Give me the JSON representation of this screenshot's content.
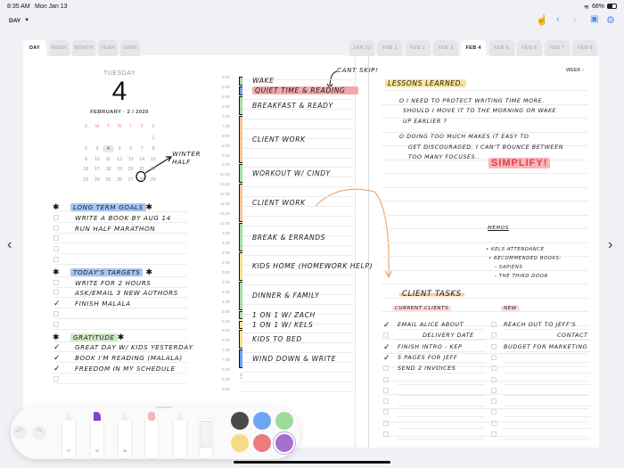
{
  "status_bar": {
    "time": "8:35 AM",
    "date": "Mon Jan 13",
    "battery": "68%"
  },
  "view_selector": {
    "label": "DAY"
  },
  "view_tabs": [
    "DAY",
    "WEEK",
    "MONTH",
    "YEAR",
    "GRID"
  ],
  "date_tabs": [
    "JAN 31",
    "FEB 1",
    "FEB 2",
    "FEB 3",
    "FEB 4",
    "FEB 5",
    "FEB 6",
    "FEB 7",
    "FEB 8"
  ],
  "active_date_tab": "FEB 4",
  "day_header": {
    "weekday": "TUESDAY",
    "day": "4",
    "month_line": "FEBRUARY · 2 / 2020"
  },
  "mini_calendar": {
    "weekdays": [
      "S",
      "M",
      "T",
      "W",
      "T",
      "F",
      "S"
    ],
    "first_weekday": 6,
    "days_in_month": 29,
    "selected": 4,
    "annotation": "WINTER HALF"
  },
  "left_lists": [
    {
      "type": "header",
      "text": "LONG TERM GOALS",
      "highlight": "#a9c6f5"
    },
    {
      "text": "WRITE A BOOK BY AUG 14"
    },
    {
      "text": "RUN HALF MARATHON"
    },
    {
      "text": ""
    },
    {
      "text": ""
    },
    {
      "text": ""
    },
    {
      "type": "header",
      "text": "TODAY'S TARGETS",
      "highlight": "#a9c6f5"
    },
    {
      "text": "WRITE FOR 2 HOURS"
    },
    {
      "text": "ASK/EMAIL 3 NEW AUTHORS"
    },
    {
      "text": "FINISH MALALA",
      "checked": true
    },
    {
      "text": ""
    },
    {
      "text": ""
    },
    {
      "type": "header",
      "text": "GRATITUDE",
      "highlight": "#cfe8c6"
    },
    {
      "text": "GREAT DAY W/ KIDS YESTERDAY",
      "checked": true
    },
    {
      "text": "BOOK I'M READING (MALALA)",
      "checked": true
    },
    {
      "text": "FREEDOM IN MY SCHEDULE",
      "checked": true
    },
    {
      "text": ""
    }
  ],
  "schedule": {
    "times": [
      "5:00",
      "5:30",
      "6:00",
      "6:30",
      "7:00",
      "7:30",
      "8:00",
      "8:30",
      "9:00",
      "9:30",
      "10:00",
      "10:30",
      "11:00",
      "11:30",
      "12:00",
      "12:30",
      "1:00",
      "1:30",
      "2:00",
      "2:30",
      "3:00",
      "3:30",
      "4:00",
      "4:30",
      "5:00",
      "5:30",
      "6:00",
      "6:30",
      "7:00",
      "7:30",
      "8:00",
      "8:30",
      "9:00"
    ],
    "annotation": "CANT SKIP!",
    "events": [
      {
        "start": 0,
        "end": 1,
        "text": "WAKE",
        "color": "#a6dba0"
      },
      {
        "start": 1,
        "end": 2,
        "text": "QUIET TIME & READING",
        "color": "#6d9ef0",
        "highlight": "#f2a9ad"
      },
      {
        "start": 2,
        "end": 4,
        "text": "BREAKFAST & READY",
        "color": "#a6dba0"
      },
      {
        "start": 4,
        "end": 9,
        "text": "CLIENT WORK",
        "color": "#f5c39a"
      },
      {
        "start": 9,
        "end": 11,
        "text": "WORKOUT W/ CINDY",
        "color": "#a6dba0"
      },
      {
        "start": 11,
        "end": 15,
        "text": "CLIENT WORK",
        "color": "#f5c39a"
      },
      {
        "start": 15,
        "end": 18,
        "text": "BREAK & ERRANDS",
        "color": "#a6dba0"
      },
      {
        "start": 18,
        "end": 21,
        "text": "KIDS HOME (HOMEWORK HELP)",
        "color": "#f3e08f"
      },
      {
        "start": 21,
        "end": 24,
        "text": "DINNER & FAMILY",
        "color": "#a6dba0"
      },
      {
        "start": 24,
        "end": 25,
        "text": "1 ON 1  W/ ZACH",
        "color": "#a6dba0"
      },
      {
        "start": 25,
        "end": 26,
        "text": "1 ON 1  W/ KELS",
        "color": "#f3e08f"
      },
      {
        "start": 26,
        "end": 28,
        "text": "KIDS TO BED",
        "color": "#f3e08f"
      },
      {
        "start": 28,
        "end": 30,
        "text": "WIND DOWN & WRITE",
        "color": "#6d9ef0"
      }
    ]
  },
  "right": {
    "week_link": "WEEK",
    "lessons_title": "LESSONS LEARNED.",
    "lessons": [
      "o  I NEED TO PROTECT WRITING TIME MORE.",
      "SHOULD I MOVE IT TO THE MORNING OR WAKE",
      "UP EARLIER ?",
      "o  DOING TOO MUCH MAKES IT EASY TO",
      "GET DISCOURAGED. I CAN'T BOUNCE BETWEEN",
      "TOO MANY FOCUSES.."
    ],
    "simplify": "SIMPLIFY!",
    "memos_title": "MEMOS",
    "memos": [
      "• KELS ATTENDANCE",
      "• RECOMMENDED BOOKS:",
      "- SAPIENS",
      "- THE THIRD DOOR"
    ],
    "client_tasks_title": "CLIENT TASKS",
    "current_title": "CURRENT CLIENTS",
    "new_title": "NEW",
    "current": [
      {
        "text": "EMAIL ALICE ABOUT",
        "checked": true
      },
      {
        "text": "DELIVERY DATE"
      },
      {
        "text": "FINISH INTRO - KEP",
        "checked": true
      },
      {
        "text": "5 PAGES FOR JEFF",
        "checked": true
      },
      {
        "text": "SEND 2 INVOICES"
      },
      {
        "text": ""
      },
      {
        "text": ""
      },
      {
        "text": ""
      },
      {
        "text": ""
      },
      {
        "text": ""
      },
      {
        "text": ""
      }
    ],
    "new": [
      {
        "text": "REACH OUT TO JEFF'S"
      },
      {
        "text": "CONTACT"
      },
      {
        "text": "BUDGET FOR MARKETING"
      },
      {
        "text": ""
      },
      {
        "text": ""
      },
      {
        "text": ""
      },
      {
        "text": ""
      },
      {
        "text": ""
      },
      {
        "text": ""
      },
      {
        "text": ""
      },
      {
        "text": ""
      }
    ]
  },
  "toolbar": {
    "tools": [
      {
        "name": "pen",
        "label": "97"
      },
      {
        "name": "highlighter",
        "label": "91"
      },
      {
        "name": "pencil",
        "label": "50"
      },
      {
        "name": "eraser",
        "label": ""
      },
      {
        "name": "lasso",
        "label": ""
      },
      {
        "name": "ruler",
        "label": ""
      }
    ],
    "colors": [
      "#4a4a4a",
      "#6fa6f2",
      "#9edb98",
      "#f5dc82",
      "#eb7b7f",
      "#a36fd0"
    ]
  }
}
